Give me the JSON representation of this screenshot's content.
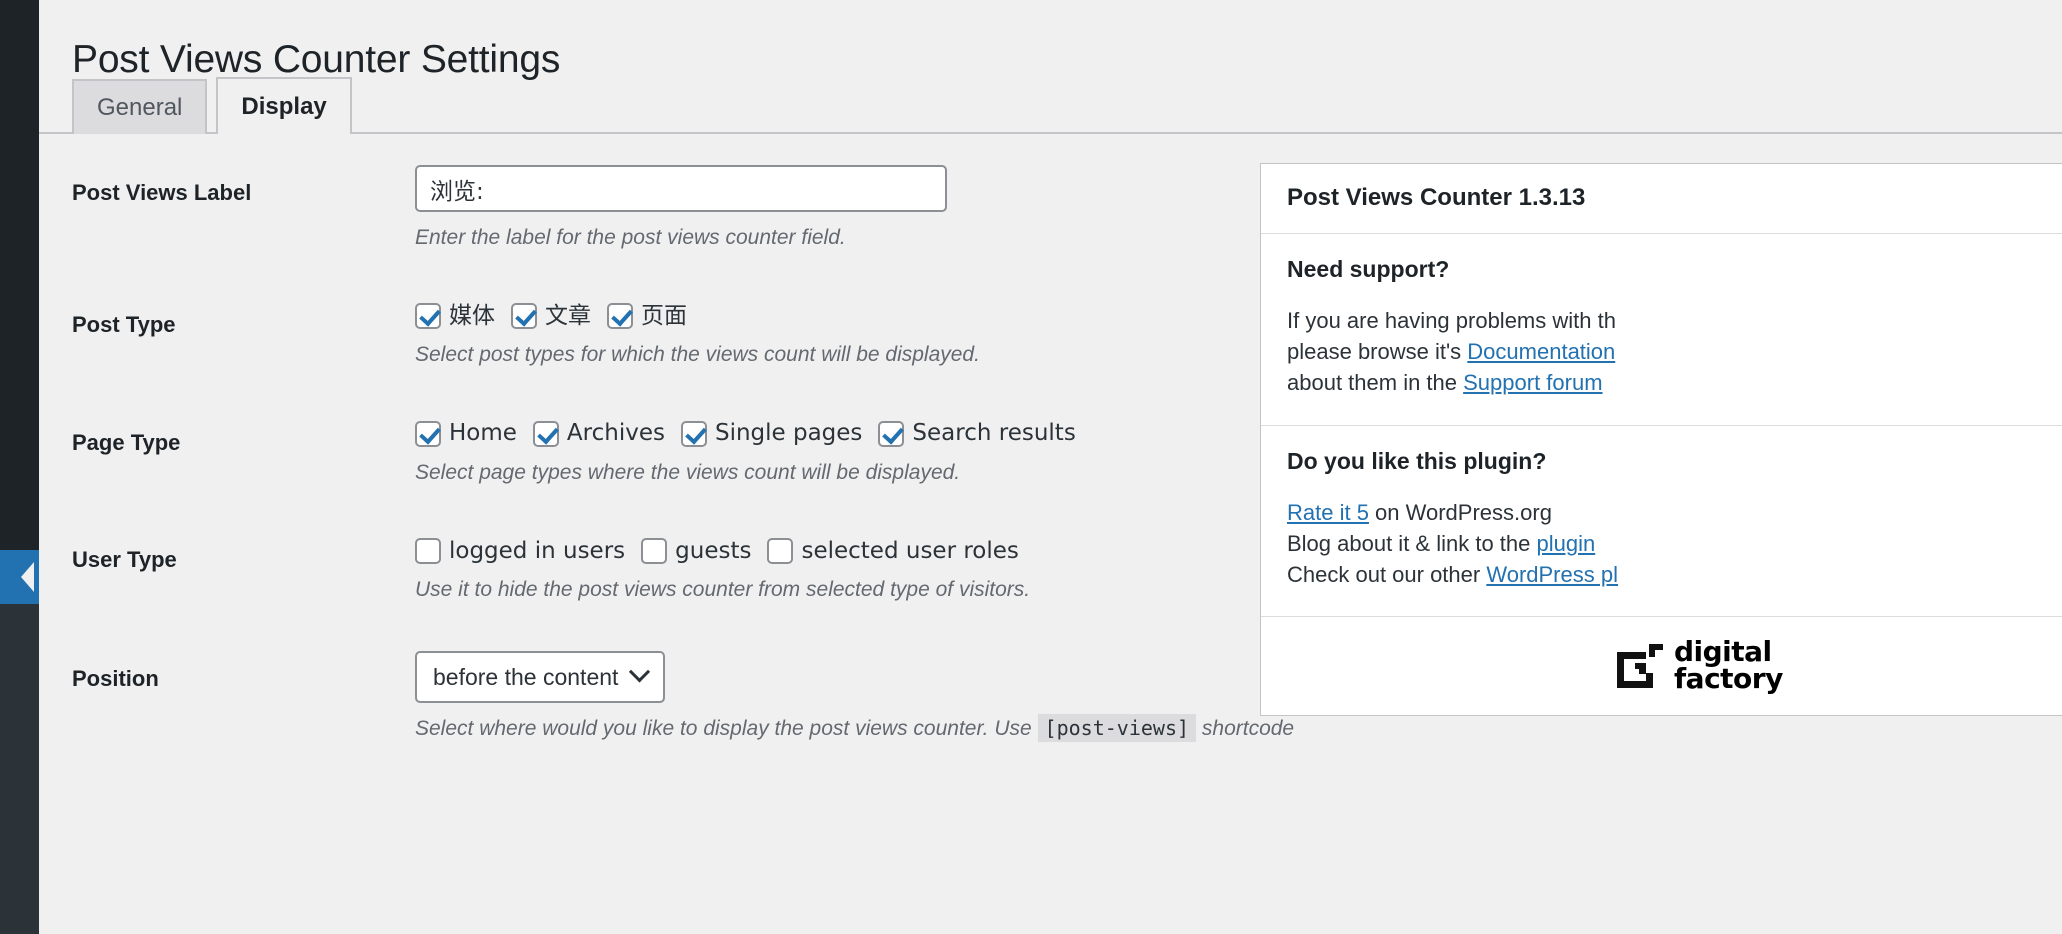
{
  "page": {
    "title": "Post Views Counter Settings"
  },
  "tabs": [
    {
      "label": "General",
      "active": false
    },
    {
      "label": "Display",
      "active": true
    }
  ],
  "form": {
    "rows": [
      {
        "id": "post-views-label",
        "label": "Post Views Label",
        "type": "text",
        "value": "浏览:",
        "placeholder": "",
        "description": "Enter the label for the post views counter field."
      },
      {
        "id": "post-type",
        "label": "Post Type",
        "type": "checkboxes",
        "options": [
          {
            "label": "媒体",
            "checked": true
          },
          {
            "label": "文章",
            "checked": true
          },
          {
            "label": "页面",
            "checked": true
          }
        ],
        "description": "Select post types for which the views count will be displayed."
      },
      {
        "id": "page-type",
        "label": "Page Type",
        "type": "checkboxes",
        "options": [
          {
            "label": "Home",
            "checked": true
          },
          {
            "label": "Archives",
            "checked": true
          },
          {
            "label": "Single pages",
            "checked": true
          },
          {
            "label": "Search results",
            "checked": true
          }
        ],
        "description": "Select page types where the views count will be displayed."
      },
      {
        "id": "user-type",
        "label": "User Type",
        "type": "checkboxes",
        "options": [
          {
            "label": "logged in users",
            "checked": false
          },
          {
            "label": "guests",
            "checked": false
          },
          {
            "label": "selected user roles",
            "checked": false
          }
        ],
        "description": "Use it to hide the post views counter from selected type of visitors."
      },
      {
        "id": "position",
        "label": "Position",
        "type": "select",
        "value": "before the content",
        "description_pre": "Select where would you like to display the post views counter. Use",
        "description_code": "[post-views]",
        "description_post": "shortcode"
      }
    ]
  },
  "sidebar": {
    "title": "Post Views Counter 1.3.13",
    "support": {
      "heading": "Need support?",
      "line1": "If you are having problems with th",
      "line2_pre": "please browse it's ",
      "line2_link": "Documentation",
      "line3_pre": "about them in the ",
      "line3_link": "Support forum"
    },
    "like": {
      "heading": "Do you like this plugin?",
      "rate_link": "Rate it 5",
      "rate_rest": " on WordPress.org",
      "blog_pre": "Blog about it & link to the ",
      "blog_link": "plugin",
      "check_pre": "Check out our other ",
      "check_link": "WordPress pl"
    },
    "logo": {
      "line1": "digital",
      "line2": "factory"
    }
  },
  "colors": {
    "accent": "#2271b1",
    "rail": "#1d2327",
    "background": "#f0f0f1",
    "border": "#c3c4c7"
  }
}
